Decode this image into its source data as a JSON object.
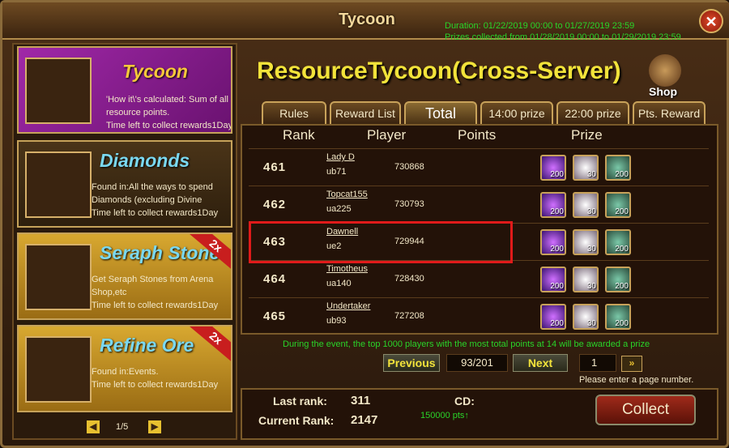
{
  "window": {
    "title": "Tycoon",
    "duration_line": "Duration: 01/22/2019 00:00 to 01/27/2019 23:59",
    "prizes_line": "Prizes collected from 01/28/2019 00:00 to 01/29/2019 23:59",
    "close_glyph": "✕"
  },
  "left": {
    "cards": [
      {
        "name": "Tycoon",
        "desc1": "'How it\\'s calculated: Sum of all resource points.",
        "desc2": "Time left to collect rewards1Day"
      },
      {
        "name": "Diamonds",
        "desc1": "Found in:All the ways to spend Diamonds (excluding Divine",
        "desc2": "Time left to collect rewards1Day"
      },
      {
        "name": "Seraph Stones",
        "desc1": "Get Seraph Stones from Arena Shop,etc",
        "desc2": "Time left to collect rewards1Day",
        "badge": "2x"
      },
      {
        "name": "Refine Ore",
        "desc1": "Found in:Events.",
        "desc2": "Time left to collect rewards1Day",
        "badge": "2x"
      }
    ],
    "pager": {
      "text": "1/5",
      "prev": "◀",
      "next": "▶"
    }
  },
  "right": {
    "headline": "ResourceTycoon(Cross-Server)",
    "shop_label": "Shop",
    "tabs": [
      {
        "label": "Rules"
      },
      {
        "label": "Reward List"
      },
      {
        "label": "Total"
      },
      {
        "label": "14:00 prize"
      },
      {
        "label": "22:00 prize"
      },
      {
        "label": "Pts. Reward"
      }
    ],
    "columns": {
      "rank": "Rank",
      "player": "Player",
      "points": "Points",
      "prize": "Prize"
    },
    "rows": [
      {
        "rank": "461",
        "name": "Lady D",
        "server": "ub71",
        "points": "730868",
        "p1": "200",
        "p2": "30",
        "p3": "200"
      },
      {
        "rank": "462",
        "name": "Topcat155",
        "server": "ua225",
        "points": "730793",
        "p1": "200",
        "p2": "30",
        "p3": "200"
      },
      {
        "rank": "463",
        "name": "Dawnell",
        "server": "ue2",
        "points": "729944",
        "p1": "200",
        "p2": "30",
        "p3": "200"
      },
      {
        "rank": "464",
        "name": "Timotheus",
        "server": "ua140",
        "points": "728430",
        "p1": "200",
        "p2": "30",
        "p3": "200"
      },
      {
        "rank": "465",
        "name": "Undertaker",
        "server": "ub93",
        "points": "727208",
        "p1": "200",
        "p2": "30",
        "p3": "200"
      }
    ],
    "notice": "During the event, the top 1000 players with the most total points at 14 will be awarded a prize",
    "pagination": {
      "previous": "Previous",
      "page": "93/201",
      "next": "Next",
      "input_value": "1",
      "go": "»",
      "hint": "Please enter a page number."
    },
    "stats": {
      "last_rank_label": "Last rank:",
      "last_rank_value": "311",
      "current_rank_label": "Current Rank:",
      "current_rank_value": "2147",
      "cd_label": "CD:",
      "cd_points": "150000 pts↑"
    },
    "collect_label": "Collect"
  }
}
